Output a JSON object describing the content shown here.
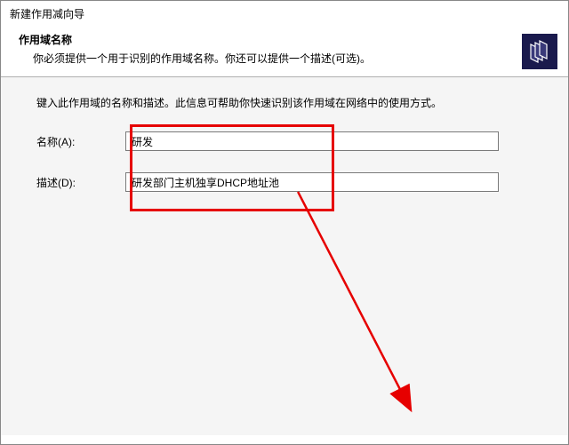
{
  "window": {
    "title": "新建作用减向导"
  },
  "header": {
    "title": "作用域名称",
    "subtitle": "你必须提供一个用于识别的作用域名称。你还可以提供一个描述(可选)。",
    "icon_name": "scope-wizard-icon"
  },
  "content": {
    "instruction": "键入此作用域的名称和描述。此信息可帮助你快速识别该作用域在网络中的使用方式。",
    "name_label": "名称(A):",
    "name_value": "研发",
    "description_label": "描述(D):",
    "description_value": "研发部门主机独享DHCP地址池"
  },
  "annotation": {
    "highlight_color": "#e60000",
    "arrow_color": "#e60000"
  }
}
